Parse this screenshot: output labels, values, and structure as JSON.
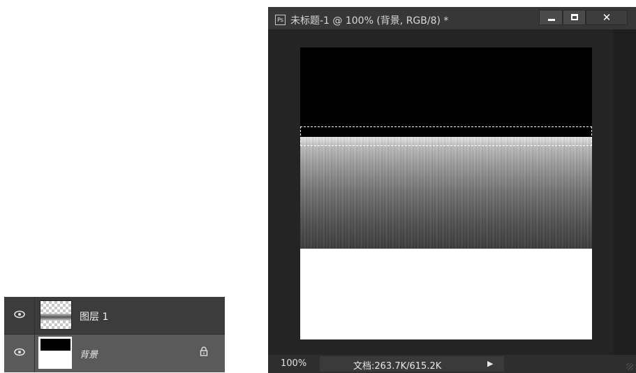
{
  "layers_panel": {
    "layers": [
      {
        "name": "图层 1",
        "visible": true,
        "thumbnail": "transparent-with-gradient"
      },
      {
        "name": "背景",
        "visible": true,
        "locked": true,
        "thumbnail": "black-over-white",
        "selected": true
      }
    ],
    "icons": {
      "visibility": "eye-icon",
      "lock": "lock-icon"
    }
  },
  "document": {
    "app_icon_text": "Ps",
    "title": "未标题-1 @ 100% (背景, RGB/8) *",
    "window_controls": {
      "minimize": "minimize-icon",
      "maximize": "maximize-icon",
      "close_label": "✕"
    },
    "status": {
      "zoom": "100%",
      "doc_size": "文档:263.7K/615.2K",
      "menu_arrow": "▶"
    }
  },
  "colors": {
    "panel_dark": "#3c3c3c",
    "panel_selected": "#5a5a5a",
    "titlebar": "#373737",
    "canvas_bg": "#242424"
  }
}
